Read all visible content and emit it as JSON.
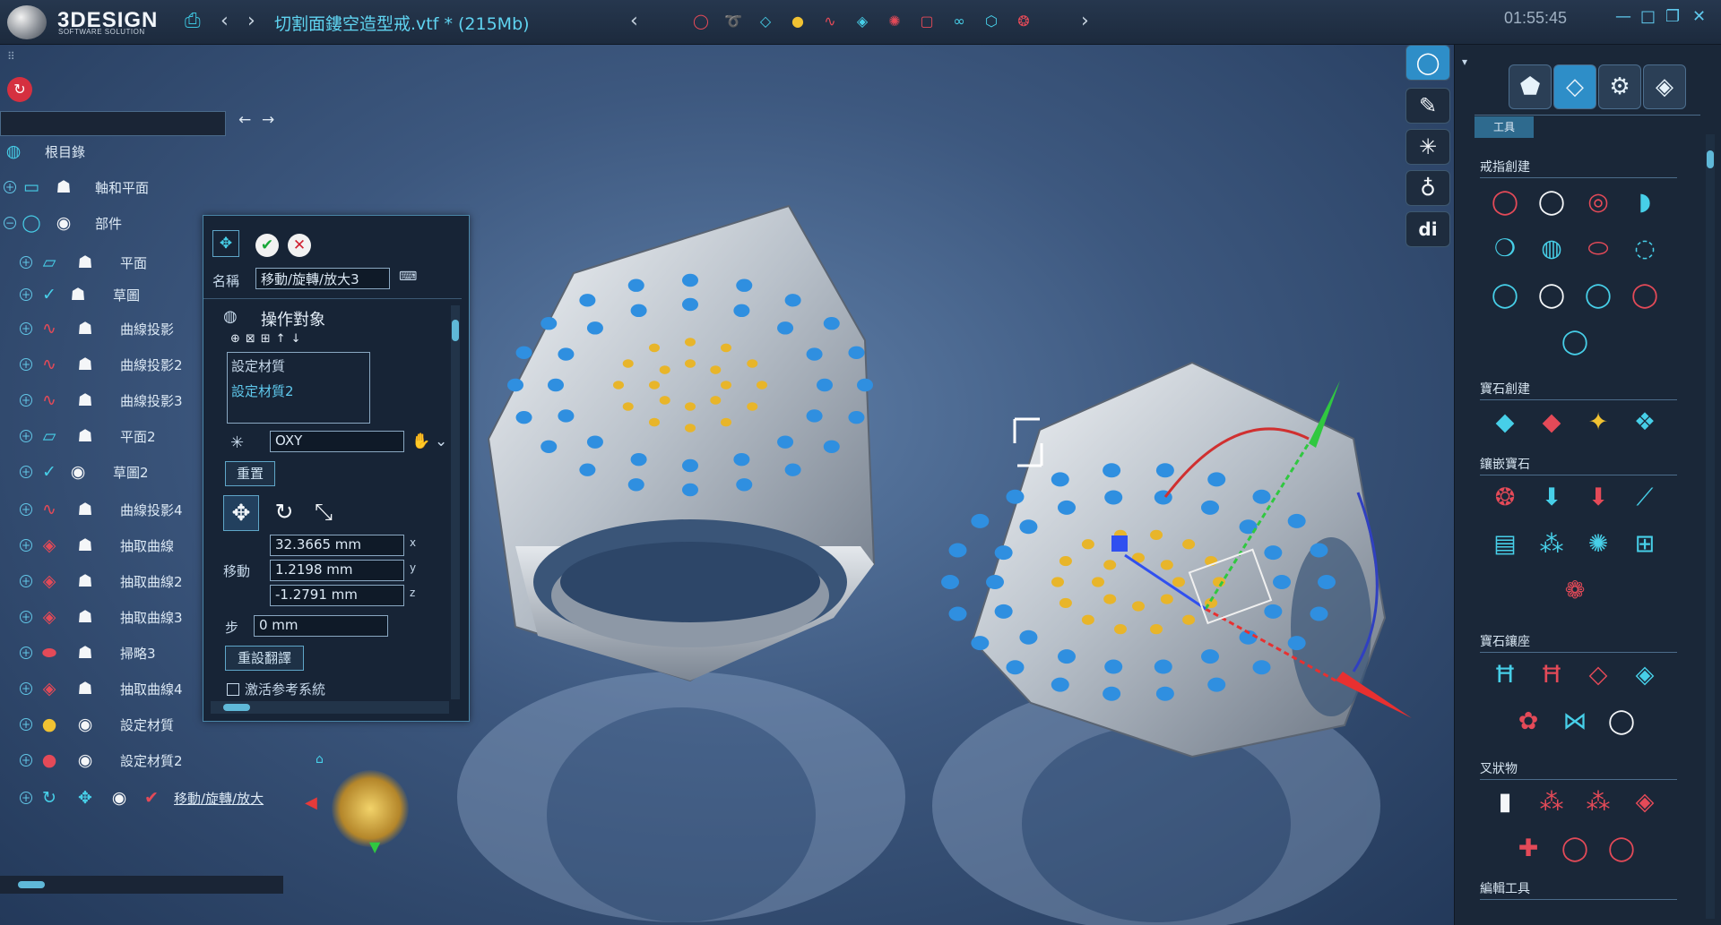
{
  "app": {
    "logo_text": "3DESIGN",
    "logo_sub": "SOFTWARE SOLUTION",
    "document_title": "切割面鏤空造型戒.vtf * (215Mb)",
    "clock": "01:55:45"
  },
  "tree": {
    "root": "根目錄",
    "axes": "軸和平面",
    "parts": "部件",
    "items": [
      {
        "label": "平面"
      },
      {
        "label": "草圖"
      },
      {
        "label": "曲線投影"
      },
      {
        "label": "曲線投影2"
      },
      {
        "label": "曲線投影3"
      },
      {
        "label": "平面2"
      },
      {
        "label": "草圖2"
      },
      {
        "label": "曲線投影4"
      },
      {
        "label": "抽取曲線"
      },
      {
        "label": "抽取曲線2"
      },
      {
        "label": "抽取曲線3"
      },
      {
        "label": "掃略3"
      },
      {
        "label": "抽取曲線4"
      },
      {
        "label": "設定材質"
      },
      {
        "label": "設定材質2"
      },
      {
        "label": "移動/旋轉/放大"
      }
    ]
  },
  "op_panel": {
    "name_label": "名稱",
    "name_value": "移動/旋轉/放大3",
    "section_title": "操作對象",
    "targets": [
      "設定材質",
      "設定材質2"
    ],
    "plane_value": "OXY",
    "reset_label": "重置",
    "move_label": "移動",
    "x_value": "32.3665 mm",
    "y_value": "1.2198 mm",
    "z_value": "-1.2791 mm",
    "step_label": "步",
    "step_value": "0 mm",
    "reset_flip_label": "重設翻譯",
    "activate_ref_label": "激活参考系統",
    "axis_x": "x",
    "axis_y": "y",
    "axis_z": "z"
  },
  "right_panel": {
    "tab_label": "工具",
    "sections": [
      "戒指創建",
      "寶石創建",
      "鑲嵌寶石",
      "寶石鑲座",
      "叉狀物",
      "編輯工具"
    ]
  },
  "colors": {
    "accent": "#47cfe8",
    "red_icon": "#e44a58",
    "background": "#213350"
  }
}
